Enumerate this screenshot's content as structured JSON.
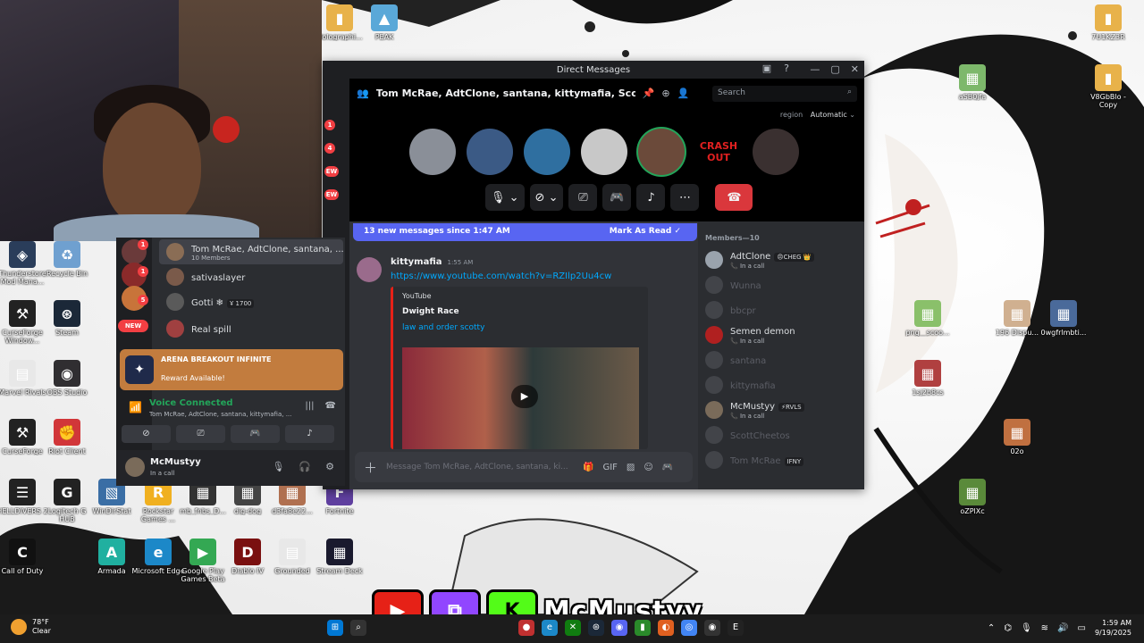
{
  "desktop": {
    "icons": [
      {
        "label": "Holographi...",
        "color": "#e8b24a",
        "glyph": "▮"
      },
      {
        "label": "PEAK",
        "color": "#5aa8d8",
        "glyph": "▲"
      },
      {
        "label": "7U1KZ3R",
        "color": "#e8b24a",
        "glyph": "▮"
      },
      {
        "label": "aSB0jfa",
        "color": "#7db86b",
        "glyph": "▦"
      },
      {
        "label": "V8GbBlo - Copy",
        "color": "#e8b24a",
        "glyph": "▮"
      },
      {
        "label": "Thunderstore Mod Mana...",
        "color": "#2a3d5a",
        "glyph": "◈"
      },
      {
        "label": "Recycle Bin",
        "color": "#6fa0d0",
        "glyph": "♻"
      },
      {
        "label": "CurseForge Window...",
        "color": "#222",
        "glyph": "⚒"
      },
      {
        "label": "Steam",
        "color": "#1b2838",
        "glyph": "⊛"
      },
      {
        "label": "Marvel Rivals",
        "color": "#e8e8e8",
        "glyph": "▤"
      },
      {
        "label": "OBS Studio",
        "color": "#302e31",
        "glyph": "◉"
      },
      {
        "label": "CurseForge",
        "color": "#222",
        "glyph": "⚒"
      },
      {
        "label": "Riot Client",
        "color": "#d13639",
        "glyph": "✊"
      },
      {
        "label": "HELLDIVERS 2",
        "color": "#222",
        "glyph": "☰"
      },
      {
        "label": "Logitech G HUB",
        "color": "#222",
        "glyph": "G"
      },
      {
        "label": "WinDirStat",
        "color": "#3a6ea5",
        "glyph": "▧"
      },
      {
        "label": "Rockstar Games ...",
        "color": "#f0b020",
        "glyph": "R"
      },
      {
        "label": "mb_fnbs_D...",
        "color": "#333",
        "glyph": "▦"
      },
      {
        "label": "dig-dog",
        "color": "#444",
        "glyph": "▦"
      },
      {
        "label": "d3fa8e22...",
        "color": "#b07050",
        "glyph": "▦"
      },
      {
        "label": "Fortnite",
        "color": "#6040a0",
        "glyph": "F"
      },
      {
        "label": "Call of Duty",
        "color": "#111",
        "glyph": "C"
      },
      {
        "label": "Armada",
        "color": "#20b0a0",
        "glyph": "A"
      },
      {
        "label": "Microsoft Edge",
        "color": "#1c88c8",
        "glyph": "e"
      },
      {
        "label": "Google Play Games Beta",
        "color": "#34a853",
        "glyph": "▶"
      },
      {
        "label": "Diablo IV",
        "color": "#7a1010",
        "glyph": "D"
      },
      {
        "label": "Grounded",
        "color": "#e8e8e8",
        "glyph": "▤"
      },
      {
        "label": "Stream Deck",
        "color": "#1a1a2e",
        "glyph": "▦"
      },
      {
        "label": "png__scoo...",
        "color": "#8ac06a",
        "glyph": "▦"
      },
      {
        "label": "196 Dispu...",
        "color": "#d0b090",
        "glyph": "▦"
      },
      {
        "label": "0wgfrlmbti...",
        "color": "#4a6a9a",
        "glyph": "▦"
      },
      {
        "label": "1sj2b8cs",
        "color": "#b04040",
        "glyph": "▦"
      },
      {
        "label": "02o",
        "color": "#c07040",
        "glyph": "▦"
      },
      {
        "label": "oZPlXc",
        "color": "#5a8a3a",
        "glyph": "▦"
      }
    ]
  },
  "window": {
    "title": "Direct Messages",
    "controls": [
      "—",
      "▢",
      "✕"
    ]
  },
  "header": {
    "group_name": "Tom McRae, AdtClone, santana, kittymafia, ScottCheetos, Sen",
    "search_placeholder": "Search",
    "region_label": "region",
    "region_value": "Automatic"
  },
  "call": {
    "participants": [
      {
        "color": "#8a8f98",
        "speaking": false
      },
      {
        "color": "#3b5a85",
        "speaking": false
      },
      {
        "color": "#2f6fa0",
        "speaking": false
      },
      {
        "color": "#c8c8c8",
        "speaking": false
      },
      {
        "color": "#6b4a3a",
        "speaking": true
      },
      {
        "color": "#000000",
        "text": "CRASH OUT",
        "speaking": false
      },
      {
        "color": "#3a3030",
        "speaking": false
      }
    ]
  },
  "chat": {
    "new_messages_text": "13 new messages since 1:47 AM",
    "mark_as_read": "Mark As Read",
    "message": {
      "author": "kittymafia",
      "time": "1:55 AM",
      "link": "https://www.youtube.com/watch?v=RZIlp2Uu4cw",
      "embed_provider": "YouTube",
      "embed_title": "Dwight Race",
      "embed_video_title": "law and order scotty"
    },
    "composer_placeholder": "Message Tom McRae, AdtClone, santana, ki..."
  },
  "members": {
    "heading": "Members—10",
    "list": [
      {
        "name": "AdtClone",
        "sub": "In a call",
        "tag": "😠CHEG 👑",
        "offline": false,
        "color": "#9aa3ad"
      },
      {
        "name": "Wunna",
        "sub": "",
        "tag": "",
        "offline": true,
        "color": "#6d6f78"
      },
      {
        "name": "bbcpr",
        "sub": "",
        "tag": "",
        "offline": true,
        "color": "#6d6f78"
      },
      {
        "name": "Semen demon",
        "sub": "In a call",
        "tag": "",
        "offline": false,
        "color": "#b02020"
      },
      {
        "name": "santana",
        "sub": "",
        "tag": "",
        "offline": true,
        "color": "#6d6f78"
      },
      {
        "name": "kittymafia",
        "sub": "",
        "tag": "",
        "offline": true,
        "color": "#6d6f78"
      },
      {
        "name": "McMustyy",
        "sub": "In a call",
        "tag": "⚡RVLS",
        "offline": false,
        "color": "#7a6b5a"
      },
      {
        "name": "ScottCheetos",
        "sub": "",
        "tag": "",
        "offline": true,
        "color": "#6d6f78"
      },
      {
        "name": "Tom McRae",
        "sub": "",
        "tag": "IFNY",
        "offline": true,
        "color": "#6d6f78"
      }
    ]
  },
  "mini": {
    "dm_list": [
      {
        "name": "Tom McRae, AdtClone, santana, ...",
        "sub": "10 Members",
        "active": true,
        "color": "#8a6d55"
      },
      {
        "name": "sativaslayer",
        "sub": "",
        "active": false,
        "color": "#7a5a4a"
      },
      {
        "name": "Gotti ❄",
        "sub": "",
        "badge": "Ұ 1700",
        "active": false,
        "color": "#5a5a5a"
      },
      {
        "name": "Real spill",
        "sub": "",
        "active": false,
        "color": "#a04040"
      }
    ],
    "guild_badges": [
      "1",
      "1",
      "5"
    ],
    "new_label": "NEW",
    "side_badges": [
      "1",
      "4",
      "EW",
      "EW"
    ],
    "promo_brand": "ARENA BREAKOUT INFINITE",
    "promo_text": "Reward Available!",
    "voice_title": "Voice Connected",
    "voice_sub": "Tom McRae, AdtClone, santana, kittymafia, ...",
    "user_name": "McMustyy",
    "user_status": "In a call"
  },
  "overlay": {
    "handle": "McMustyy",
    "badges": [
      {
        "glyph": "▶",
        "color": "#e62117"
      },
      {
        "glyph": "⧉",
        "color": "#9146ff"
      },
      {
        "glyph": "K",
        "color": "#53fc18"
      }
    ]
  },
  "taskbar": {
    "temp": "78°F",
    "condition": "Clear",
    "time": "1:59 AM",
    "date": "9/19/2025"
  },
  "colors": {
    "blurple": "#5865f2",
    "green": "#23a55a",
    "red": "#da373c"
  }
}
